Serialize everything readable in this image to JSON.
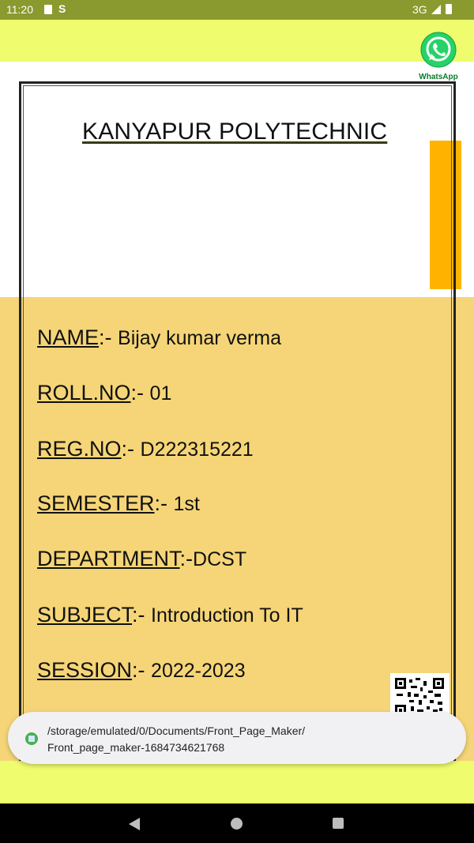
{
  "status_bar": {
    "time": "11:20",
    "s_glyph": "S",
    "network": "3G"
  },
  "whatsapp": {
    "label": "WhatsApp"
  },
  "document": {
    "title": "KANYAPUR POLYTECHNIC",
    "fields": [
      {
        "label": "NAME",
        "sep": ":- ",
        "value": "Bijay kumar verma"
      },
      {
        "label": "ROLL.NO",
        "sep": ":-  ",
        "value": "01"
      },
      {
        "label": "REG.NO",
        "sep": ":-  ",
        "value": "D222315221"
      },
      {
        "label": "SEMESTER",
        "sep": ":- ",
        "value": "1st"
      },
      {
        "label": "DEPARTMENT",
        "sep": ":-",
        "value": "DCST"
      },
      {
        "label": "SUBJECT",
        "sep": ":-  ",
        "value": "Introduction To IT"
      },
      {
        "label": "SESSION",
        "sep": ":-  ",
        "value": "2022-2023"
      }
    ]
  },
  "toast": {
    "line1": "/storage/emulated/0/Documents/Front_Page_Maker/",
    "line2": "Front_page_maker-1684734621768"
  },
  "colors": {
    "status_bar": "#8a9a2e",
    "band": "#eefc6d",
    "page": "#f5d577",
    "accent": "#ffb300"
  },
  "icons": [
    "sd-card-icon",
    "s-icon",
    "signal-icon",
    "battery-icon",
    "whatsapp-icon",
    "qr-code-icon",
    "app-icon",
    "back-icon",
    "home-icon",
    "recents-icon"
  ]
}
